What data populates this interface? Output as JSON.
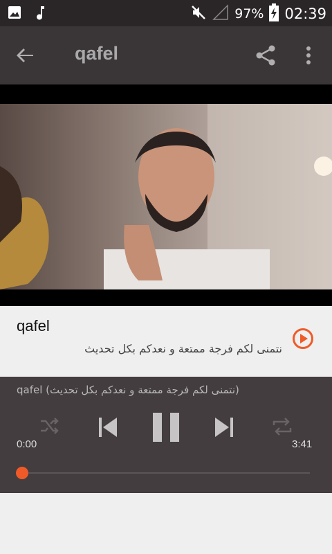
{
  "status_bar": {
    "battery_percent": "97%",
    "time": "02:39",
    "icons": [
      "image-icon",
      "music-note-icon",
      "mute-icon",
      "signal-icon",
      "battery-charging-icon"
    ]
  },
  "app_bar": {
    "title": "qafel",
    "icons": [
      "back-arrow-icon",
      "share-icon",
      "more-vert-icon"
    ]
  },
  "track": {
    "name": "qafel",
    "description": "نتمنى لكم فرجة ممتعة و نعدكم بكل تحديث"
  },
  "player": {
    "now_playing": "qafel (نتمنى لكم فرجة ممتعة و نعدكم بكل تحديث)",
    "current_time": "0:00",
    "duration": "3:41",
    "progress": 0,
    "state": "playing",
    "controls": [
      "shuffle-icon",
      "previous-icon",
      "pause-icon",
      "next-icon",
      "repeat-icon"
    ]
  },
  "colors": {
    "accent": "#f05a28",
    "status_bar": "#2a2628",
    "app_bar": "#3a3536",
    "player_bg": "#433d3f",
    "info_bg": "#efefef"
  }
}
